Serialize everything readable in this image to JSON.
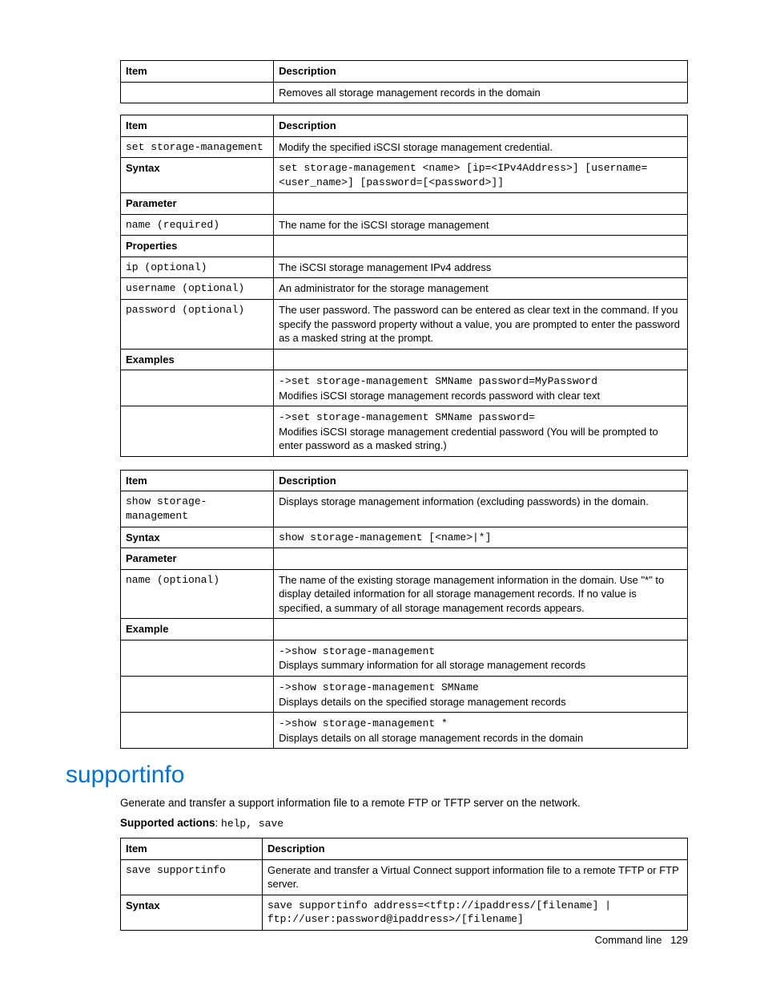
{
  "table1": {
    "headers": [
      "Item",
      "Description"
    ],
    "rows": [
      {
        "item": "",
        "desc": "Removes all storage management records in the domain"
      }
    ]
  },
  "table2": {
    "headers": [
      "Item",
      "Description"
    ],
    "rows": [
      {
        "item_mono": "set storage-management",
        "desc": "Modify the specified iSCSI storage management credential."
      },
      {
        "item_bold": "Syntax",
        "desc_mono": "set storage-management <name> [ip=<IPv4Address>] [username=<user_name>] [password=[<password>]]"
      },
      {
        "item_bold": "Parameter",
        "desc": ""
      },
      {
        "item_mono": "name (required)",
        "desc": "The name for the iSCSI storage management"
      },
      {
        "item_bold": "Properties",
        "desc": ""
      },
      {
        "item_mono": "ip (optional)",
        "desc": "The iSCSI storage management IPv4 address"
      },
      {
        "item_mono": "username (optional)",
        "desc": "An administrator for the storage management"
      },
      {
        "item_mono": "password (optional)",
        "desc": "The user password. The password can be entered as clear text in the command. If you specify the password property without a value, you are prompted to enter the password as a masked string at the prompt."
      },
      {
        "item_bold": "Examples",
        "desc": ""
      },
      {
        "item": "",
        "desc_mono_first": "->set storage-management SMName password=MyPassword",
        "desc_after": "Modifies iSCSI storage management records password with clear text"
      },
      {
        "item": "",
        "desc_mono_first": "->set storage-management SMName password=",
        "desc_after": "Modifies iSCSI storage management credential password (You will be prompted to enter password as a masked string.)"
      }
    ]
  },
  "table3": {
    "headers": [
      "Item",
      "Description"
    ],
    "rows": [
      {
        "item_mono": "show storage-management",
        "desc": "Displays storage management information (excluding passwords) in the domain."
      },
      {
        "item_bold": "Syntax",
        "desc_mono": "show storage-management [<name>|*]"
      },
      {
        "item_bold": "Parameter",
        "desc": ""
      },
      {
        "item_mono": "name (optional)",
        "desc": "The name of the existing storage management information in the domain. Use \"*\" to display detailed information for all storage management records. If no value is specified, a summary of all storage management records appears."
      },
      {
        "item_bold": "Example",
        "desc": ""
      },
      {
        "item": "",
        "desc_mono_first": "->show storage-management",
        "desc_after": "Displays summary information for all storage management records"
      },
      {
        "item": "",
        "desc_mono_first": "->show storage-management SMName",
        "desc_after": "Displays details on the specified storage management records"
      },
      {
        "item": "",
        "desc_mono_first": "->show storage-management *",
        "desc_after": "Displays details on all storage management records in the domain"
      }
    ]
  },
  "section_heading": "supportinfo",
  "intro_paragraph": "Generate and transfer a support information file to a remote FTP or TFTP server on the network.",
  "supported_actions_label": "Supported actions",
  "supported_actions_value": "help, save",
  "table4": {
    "headers": [
      "Item",
      "Description"
    ],
    "rows": [
      {
        "item_mono": "save supportinfo",
        "desc": "Generate and transfer a Virtual Connect support information file to a remote TFTP or FTP server."
      },
      {
        "item_bold": "Syntax",
        "desc_mono": "save supportinfo address=<tftp://ipaddress/[filename] | ftp://user:password@ipaddress>/[filename]"
      }
    ]
  },
  "footer_text": "Command line",
  "footer_page": "129"
}
